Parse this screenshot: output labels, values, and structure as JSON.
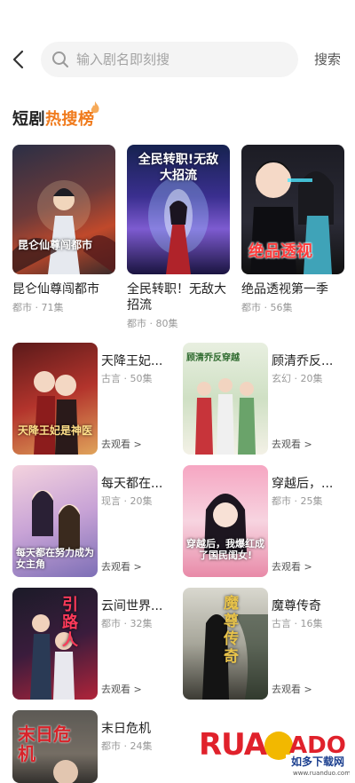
{
  "search": {
    "placeholder": "输入剧名即刻搜",
    "button_label": "搜索"
  },
  "section": {
    "title_prefix": "短剧",
    "title_hot": "热搜榜"
  },
  "top_dramas": [
    {
      "title": "昆仑仙尊闯都市",
      "meta": "都市 · 71集",
      "cover_text": "昆仑仙尊闯都市"
    },
    {
      "title": "全民转职！无敌大招流",
      "meta": "都市 · 80集",
      "cover_text": "全民转职!无敌大招流"
    },
    {
      "title": "绝品透视第一季",
      "meta": "都市 · 56集",
      "cover_text": "绝品透视"
    }
  ],
  "list_dramas": [
    {
      "title": "天降王妃...",
      "meta": "古言 · 50集",
      "link": "去观看 >",
      "cover_text": "天降王妃是神医"
    },
    {
      "title": "顾清乔反...",
      "meta": "玄幻 · 20集",
      "link": "去观看 >",
      "cover_text": "顾清乔反穿越"
    },
    {
      "title": "每天都在...",
      "meta": "现言 · 20集",
      "link": "去观看 >",
      "cover_text": "每天都在努力成为女主角"
    },
    {
      "title": "穿越后，...",
      "meta": "都市 · 25集",
      "link": "去观看 >",
      "cover_text": "穿越后，我爆红成了国民闺女!"
    },
    {
      "title": "云间世界...",
      "meta": "都市 · 32集",
      "link": "去观看 >",
      "cover_text": "引路人"
    },
    {
      "title": "魔尊传奇",
      "meta": "古言 · 16集",
      "link": "去观看 >",
      "cover_text": "魔尊传奇"
    },
    {
      "title": "末日危机",
      "meta": "都市 · 24集",
      "link": "",
      "cover_text": "末日危机"
    }
  ],
  "watermark": {
    "logo": "RUANDADO",
    "subtitle": "如多下载网",
    "url": "www.ruanduo.com"
  },
  "colors": {
    "accent": "#f07b1d",
    "meta": "#999999",
    "search_bg": "#f4f4f4"
  }
}
